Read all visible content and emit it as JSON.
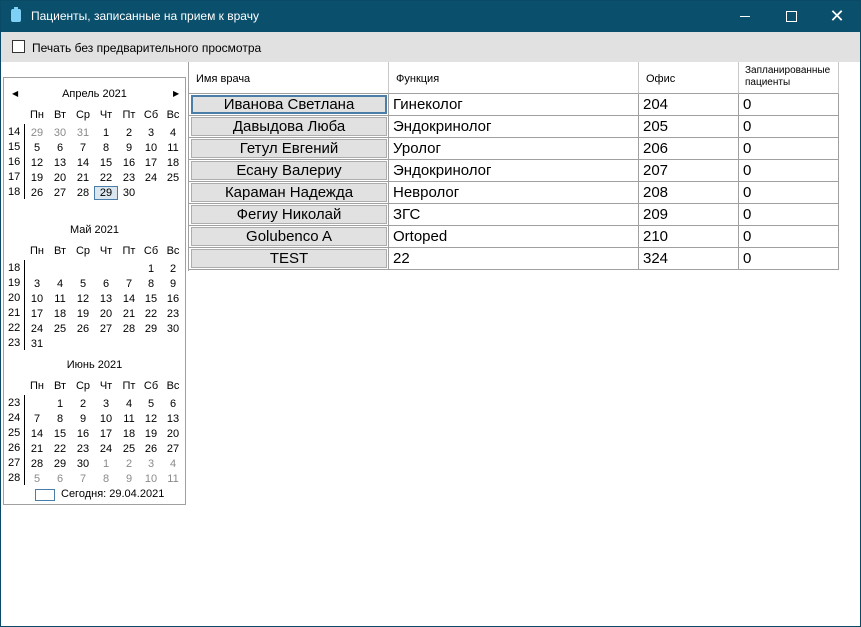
{
  "window": {
    "title": "Пациенты, записанные на прием к врачу"
  },
  "toolbar": {
    "print_checkbox_label": "Печать без предварительного просмотра",
    "print_checked": false
  },
  "calendar": {
    "weekday_names": [
      "Пн",
      "Вт",
      "Ср",
      "Чт",
      "Пт",
      "Сб",
      "Вс"
    ],
    "today_label": "Сегодня: 29.04.2021",
    "months": [
      {
        "title": "Апрель 2021",
        "weeks": [
          {
            "num": "14",
            "days": [
              [
                "29",
                1
              ],
              [
                "30",
                1
              ],
              [
                "31",
                1
              ],
              [
                "1",
                0
              ],
              [
                "2",
                0
              ],
              [
                "3",
                0
              ],
              [
                "4",
                0
              ]
            ]
          },
          {
            "num": "15",
            "days": [
              [
                "5",
                0
              ],
              [
                "6",
                0
              ],
              [
                "7",
                0
              ],
              [
                "8",
                0
              ],
              [
                "9",
                0
              ],
              [
                "10",
                0
              ],
              [
                "11",
                0
              ]
            ]
          },
          {
            "num": "16",
            "days": [
              [
                "12",
                0
              ],
              [
                "13",
                0
              ],
              [
                "14",
                0
              ],
              [
                "15",
                0
              ],
              [
                "16",
                0
              ],
              [
                "17",
                0
              ],
              [
                "18",
                0
              ]
            ]
          },
          {
            "num": "17",
            "days": [
              [
                "19",
                0
              ],
              [
                "20",
                0
              ],
              [
                "21",
                0
              ],
              [
                "22",
                0
              ],
              [
                "23",
                0
              ],
              [
                "24",
                0
              ],
              [
                "25",
                0
              ]
            ]
          },
          {
            "num": "18",
            "days": [
              [
                "26",
                0
              ],
              [
                "27",
                0
              ],
              [
                "28",
                0
              ],
              [
                "29",
                2
              ],
              [
                "30",
                0
              ],
              [
                "",
                0
              ],
              [
                "",
                0
              ]
            ]
          }
        ]
      },
      {
        "title": "Май 2021",
        "weeks": [
          {
            "num": "18",
            "days": [
              [
                "",
                0
              ],
              [
                "",
                0
              ],
              [
                "",
                0
              ],
              [
                "",
                0
              ],
              [
                "",
                0
              ],
              [
                "1",
                0
              ],
              [
                "2",
                0
              ]
            ]
          },
          {
            "num": "19",
            "days": [
              [
                "3",
                0
              ],
              [
                "4",
                0
              ],
              [
                "5",
                0
              ],
              [
                "6",
                0
              ],
              [
                "7",
                0
              ],
              [
                "8",
                0
              ],
              [
                "9",
                0
              ]
            ]
          },
          {
            "num": "20",
            "days": [
              [
                "10",
                0
              ],
              [
                "11",
                0
              ],
              [
                "12",
                0
              ],
              [
                "13",
                0
              ],
              [
                "14",
                0
              ],
              [
                "15",
                0
              ],
              [
                "16",
                0
              ]
            ]
          },
          {
            "num": "21",
            "days": [
              [
                "17",
                0
              ],
              [
                "18",
                0
              ],
              [
                "19",
                0
              ],
              [
                "20",
                0
              ],
              [
                "21",
                0
              ],
              [
                "22",
                0
              ],
              [
                "23",
                0
              ]
            ]
          },
          {
            "num": "22",
            "days": [
              [
                "24",
                0
              ],
              [
                "25",
                0
              ],
              [
                "26",
                0
              ],
              [
                "27",
                0
              ],
              [
                "28",
                0
              ],
              [
                "29",
                0
              ],
              [
                "30",
                0
              ]
            ]
          },
          {
            "num": "23",
            "days": [
              [
                "31",
                0
              ],
              [
                "",
                0
              ],
              [
                "",
                0
              ],
              [
                "",
                0
              ],
              [
                "",
                0
              ],
              [
                "",
                0
              ],
              [
                "",
                0
              ]
            ]
          }
        ]
      },
      {
        "title": "Июнь 2021",
        "weeks": [
          {
            "num": "23",
            "days": [
              [
                "",
                0
              ],
              [
                "1",
                0
              ],
              [
                "2",
                0
              ],
              [
                "3",
                0
              ],
              [
                "4",
                0
              ],
              [
                "5",
                0
              ],
              [
                "6",
                0
              ]
            ]
          },
          {
            "num": "24",
            "days": [
              [
                "7",
                0
              ],
              [
                "8",
                0
              ],
              [
                "9",
                0
              ],
              [
                "10",
                0
              ],
              [
                "11",
                0
              ],
              [
                "12",
                0
              ],
              [
                "13",
                0
              ]
            ]
          },
          {
            "num": "25",
            "days": [
              [
                "14",
                0
              ],
              [
                "15",
                0
              ],
              [
                "16",
                0
              ],
              [
                "17",
                0
              ],
              [
                "18",
                0
              ],
              [
                "19",
                0
              ],
              [
                "20",
                0
              ]
            ]
          },
          {
            "num": "26",
            "days": [
              [
                "21",
                0
              ],
              [
                "22",
                0
              ],
              [
                "23",
                0
              ],
              [
                "24",
                0
              ],
              [
                "25",
                0
              ],
              [
                "26",
                0
              ],
              [
                "27",
                0
              ]
            ]
          },
          {
            "num": "27",
            "days": [
              [
                "28",
                0
              ],
              [
                "29",
                0
              ],
              [
                "30",
                0
              ],
              [
                "1",
                1
              ],
              [
                "2",
                1
              ],
              [
                "3",
                1
              ],
              [
                "4",
                1
              ]
            ]
          },
          {
            "num": "28",
            "days": [
              [
                "5",
                1
              ],
              [
                "6",
                1
              ],
              [
                "7",
                1
              ],
              [
                "8",
                1
              ],
              [
                "9",
                1
              ],
              [
                "10",
                1
              ],
              [
                "11",
                1
              ]
            ]
          }
        ]
      }
    ]
  },
  "grid": {
    "columns": [
      "Имя врача",
      "Функция",
      "Офис",
      "Запланированные пациенты"
    ],
    "rows": [
      [
        "Иванова Светлана",
        "Гинеколог",
        "204",
        "0"
      ],
      [
        "Давыдова Люба",
        "Эндокринолог",
        "205",
        "0"
      ],
      [
        "Гетул Евгений",
        "Уролог",
        "206",
        "0"
      ],
      [
        "Есану Валериу",
        "Эндокринолог",
        "207",
        "0"
      ],
      [
        "Караман Надежда",
        "Невролог",
        "208",
        "0"
      ],
      [
        "Фегиу Николай",
        "ЗГС",
        "209",
        "0"
      ],
      [
        "Golubenco A",
        "Ortoped",
        "210",
        "0"
      ],
      [
        "TEST",
        "22",
        "324",
        "0"
      ]
    ]
  }
}
